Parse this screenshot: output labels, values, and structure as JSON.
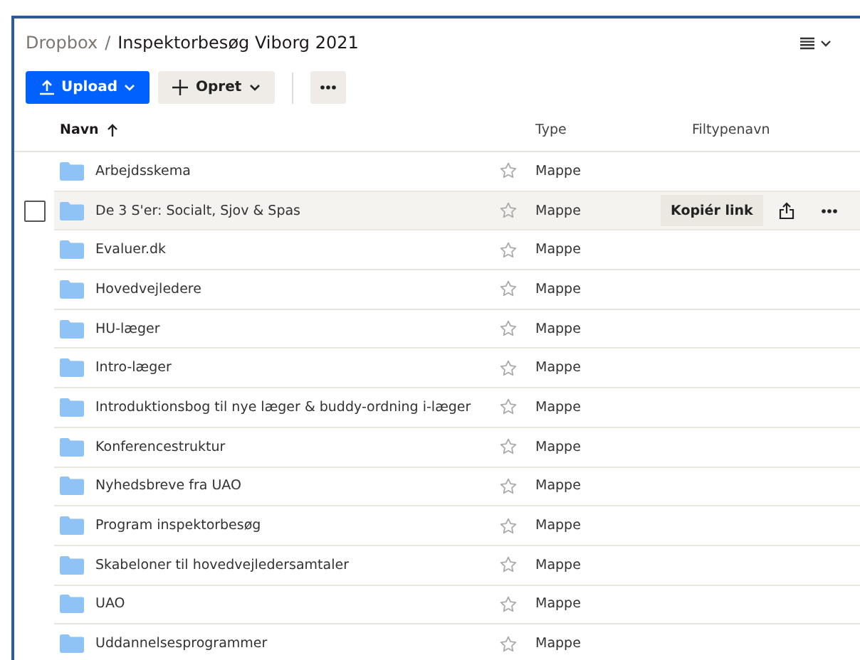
{
  "breadcrumb": {
    "root": "Dropbox",
    "separator": "/",
    "current": "Inspektorbesøg Viborg 2021"
  },
  "toolbar": {
    "upload": "Upload",
    "create": "Opret"
  },
  "columns": {
    "name": "Navn",
    "type": "Type",
    "extension": "Filtypenavn"
  },
  "row_actions": {
    "copy_link": "Kopiér link"
  },
  "rows": [
    {
      "name": "Arbejdsskema",
      "type": "Mappe",
      "hovered": false,
      "starred": false
    },
    {
      "name": "De 3 S'er: Socialt, Sjov & Spas",
      "type": "Mappe",
      "hovered": true,
      "starred": false
    },
    {
      "name": "Evaluer.dk",
      "type": "Mappe",
      "hovered": false,
      "starred": false
    },
    {
      "name": "Hovedvejledere",
      "type": "Mappe",
      "hovered": false,
      "starred": false
    },
    {
      "name": "HU-læger",
      "type": "Mappe",
      "hovered": false,
      "starred": false
    },
    {
      "name": "Intro-læger",
      "type": "Mappe",
      "hovered": false,
      "starred": false
    },
    {
      "name": "Introduktionsbog til nye læger & buddy-ordning i-læger",
      "type": "Mappe",
      "hovered": false,
      "starred": false
    },
    {
      "name": "Konferencestruktur",
      "type": "Mappe",
      "hovered": false,
      "starred": false
    },
    {
      "name": "Nyhedsbreve fra UAO",
      "type": "Mappe",
      "hovered": false,
      "starred": false
    },
    {
      "name": "Program inspektorbesøg",
      "type": "Mappe",
      "hovered": false,
      "starred": false
    },
    {
      "name": "Skabeloner til hovedvejledersamtaler",
      "type": "Mappe",
      "hovered": false,
      "starred": false
    },
    {
      "name": "UAO",
      "type": "Mappe",
      "hovered": false,
      "starred": false
    },
    {
      "name": "Uddannelsesprogrammer",
      "type": "Mappe",
      "hovered": false,
      "starred": false
    }
  ]
}
